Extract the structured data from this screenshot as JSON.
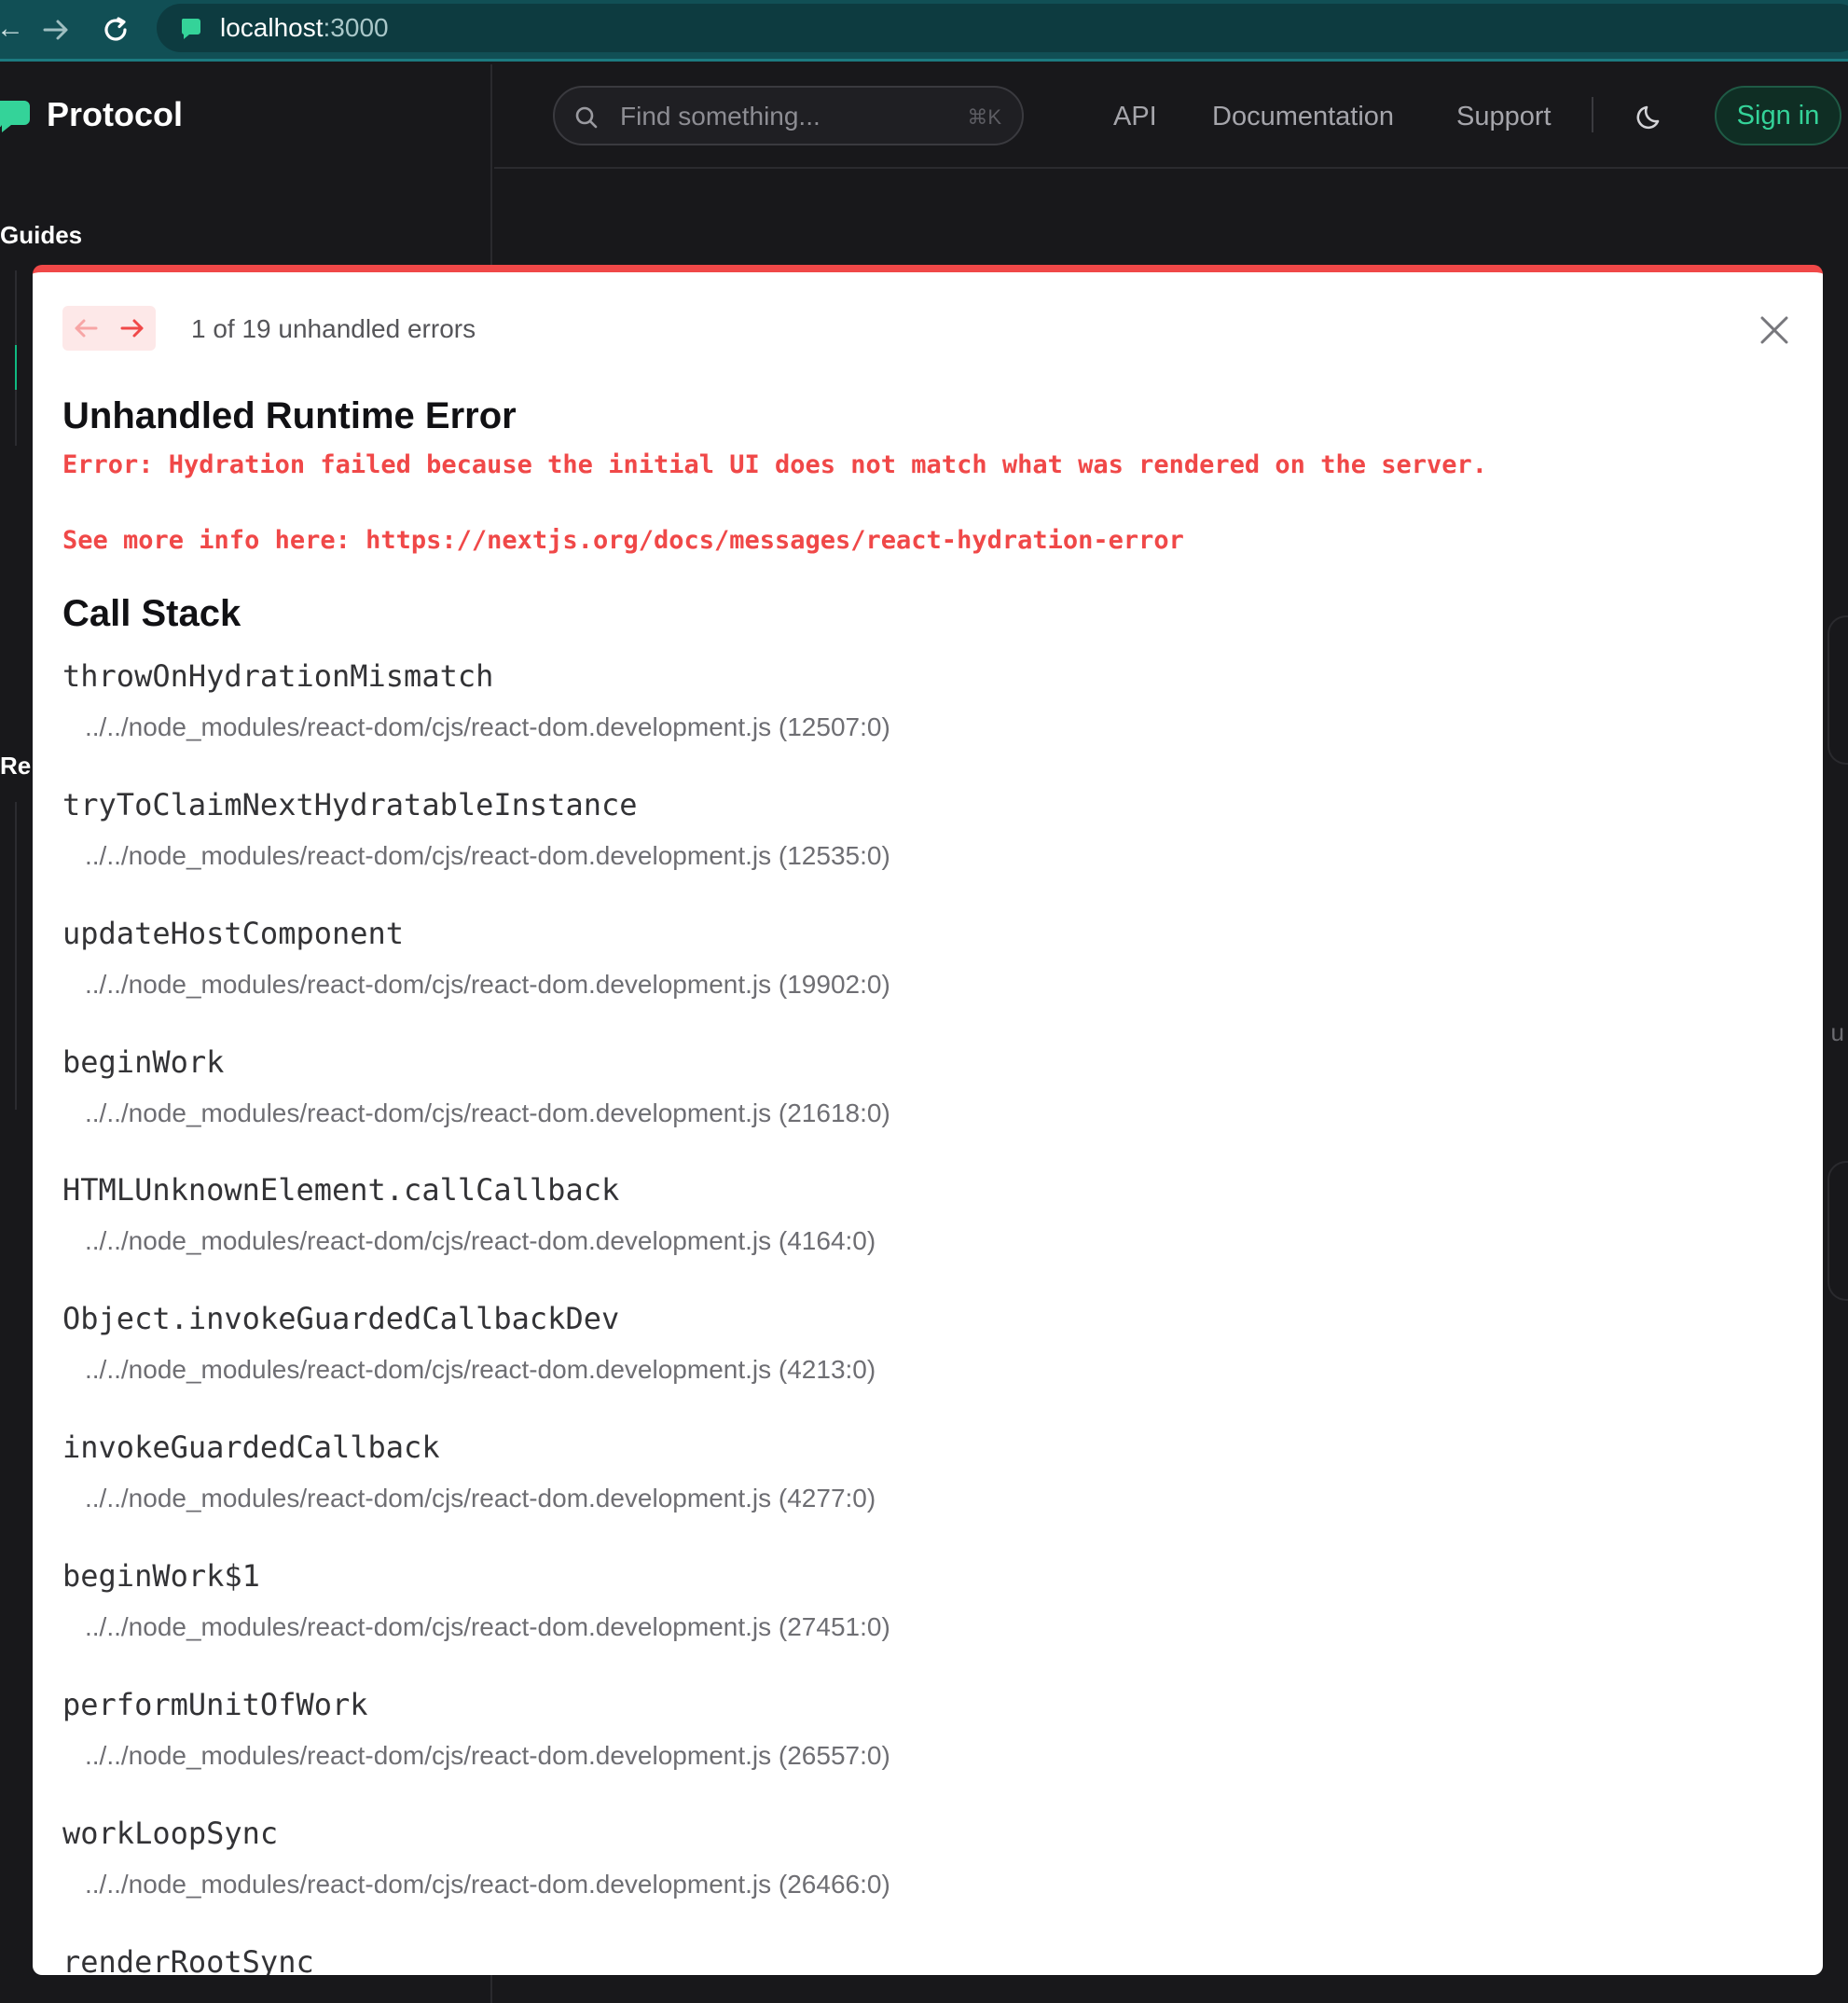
{
  "browser": {
    "back_glyph": "←",
    "url_host": "localhost",
    "url_port": ":3000"
  },
  "app": {
    "name": "Protocol",
    "sidebar": {
      "section": "Guides",
      "section_cut": "Re"
    },
    "search": {
      "placeholder": "Find something...",
      "shortcut": "⌘K"
    },
    "nav": [
      "API",
      "Documentation",
      "Support"
    ],
    "signin_label": "Sign in",
    "accent_color": "#34d399",
    "bg_glyph": "u"
  },
  "overlay": {
    "count_text": "1 of 19 unhandled errors",
    "title": "Unhandled Runtime Error",
    "message": "Error: Hydration failed because the initial UI does not match what was rendered on the server.",
    "info": "See more info here: https://nextjs.org/docs/messages/react-hydration-error",
    "callstack_heading": "Call Stack",
    "error_color": "#f04848",
    "frames": [
      {
        "fn": "throwOnHydrationMismatch",
        "file": "../../node_modules/react-dom/cjs/react-dom.development.js (12507:0)"
      },
      {
        "fn": "tryToClaimNextHydratableInstance",
        "file": "../../node_modules/react-dom/cjs/react-dom.development.js (12535:0)"
      },
      {
        "fn": "updateHostComponent",
        "file": "../../node_modules/react-dom/cjs/react-dom.development.js (19902:0)"
      },
      {
        "fn": "beginWork",
        "file": "../../node_modules/react-dom/cjs/react-dom.development.js (21618:0)"
      },
      {
        "fn": "HTMLUnknownElement.callCallback",
        "file": "../../node_modules/react-dom/cjs/react-dom.development.js (4164:0)"
      },
      {
        "fn": "Object.invokeGuardedCallbackDev",
        "file": "../../node_modules/react-dom/cjs/react-dom.development.js (4213:0)"
      },
      {
        "fn": "invokeGuardedCallback",
        "file": "../../node_modules/react-dom/cjs/react-dom.development.js (4277:0)"
      },
      {
        "fn": "beginWork$1",
        "file": "../../node_modules/react-dom/cjs/react-dom.development.js (27451:0)"
      },
      {
        "fn": "performUnitOfWork",
        "file": "../../node_modules/react-dom/cjs/react-dom.development.js (26557:0)"
      },
      {
        "fn": "workLoopSync",
        "file": "../../node_modules/react-dom/cjs/react-dom.development.js (26466:0)"
      },
      {
        "fn": "renderRootSync",
        "file": ""
      }
    ]
  }
}
